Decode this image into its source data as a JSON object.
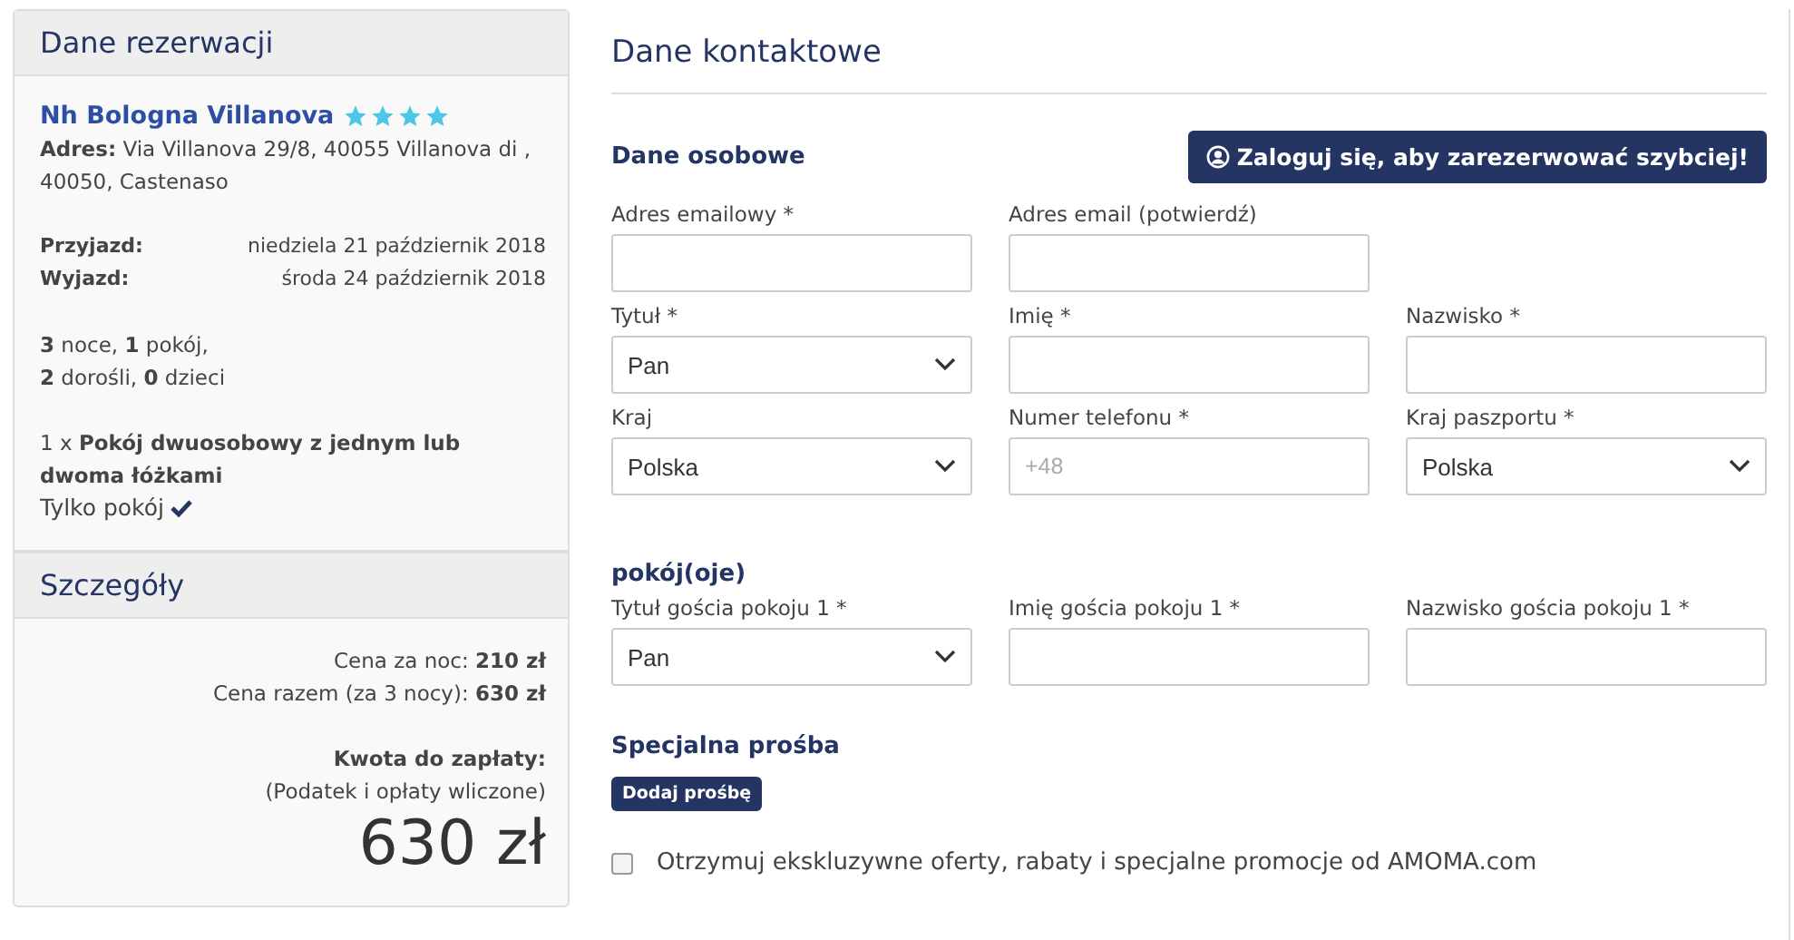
{
  "sidebar": {
    "booking": {
      "title": "Dane rezerwacji",
      "hotel_name": "Nh Bologna Villanova",
      "stars": 4,
      "address": "**Adres:** Via Villanova 29/8, 40055 Villanova di , 40050, Castenaso",
      "dates": [
        {
          "label": "Przyjazd:",
          "value": "niedziela 21 październik 2018"
        },
        {
          "label": "Wyjazd:",
          "value": "środa 24 październik 2018"
        }
      ],
      "stay_lines": [
        "**3** noce, **1** pokój,",
        "**2** dorośli, **0** dzieci"
      ],
      "room": "1 x **Pokój dwuosobowy z jednym lub dwoma łóżkami**",
      "board": "Tylko pokój",
      "board_included": true
    },
    "details": {
      "title": "Szczegóły",
      "price_lines": [
        "Cena za noc: **210 zł**",
        "Cena razem (za 3 nocy): **630 zł**"
      ],
      "total_label": "Kwota do zapłaty:",
      "total_note": "(Podatek i opłaty wliczone)",
      "total": "630 zł"
    }
  },
  "main": {
    "title": "Dane kontaktowe",
    "personal_heading": "Dane osobowe",
    "login_button": "Zaloguj się, aby zarezerwować szybciej!",
    "personal_rows": [
      [
        {
          "label": "Adres emailowy *",
          "kind": "text"
        },
        {
          "label": "Adres email (potwierdź)",
          "kind": "text"
        }
      ],
      [
        {
          "label": "Tytuł *",
          "kind": "select",
          "value": "Pan"
        },
        {
          "label": "Imię *",
          "kind": "text"
        },
        {
          "label": "Nazwisko *",
          "kind": "text"
        }
      ],
      [
        {
          "label": "Kraj",
          "kind": "select",
          "value": "Polska"
        },
        {
          "label": "Numer telefonu *",
          "kind": "text",
          "placeholder": "+48"
        },
        {
          "label": "Kraj paszportu *",
          "kind": "select",
          "value": "Polska"
        }
      ]
    ],
    "rooms_heading": "pokój(oje)",
    "room_rows": [
      [
        {
          "label": "Tytuł gościa pokoju 1 *",
          "kind": "select",
          "value": "Pan"
        },
        {
          "label": "Imię gościa pokoju 1 *",
          "kind": "text"
        },
        {
          "label": "Nazwisko gościa pokoju 1 *",
          "kind": "text"
        }
      ]
    ],
    "special_heading": "Specjalna prośba",
    "add_request_button": "Dodaj prośbę",
    "offers_checkbox": {
      "label": "Otrzymuj ekskluzywne oferty, rabaty i specjalne promocje od AMOMA.com",
      "checked": false
    }
  }
}
